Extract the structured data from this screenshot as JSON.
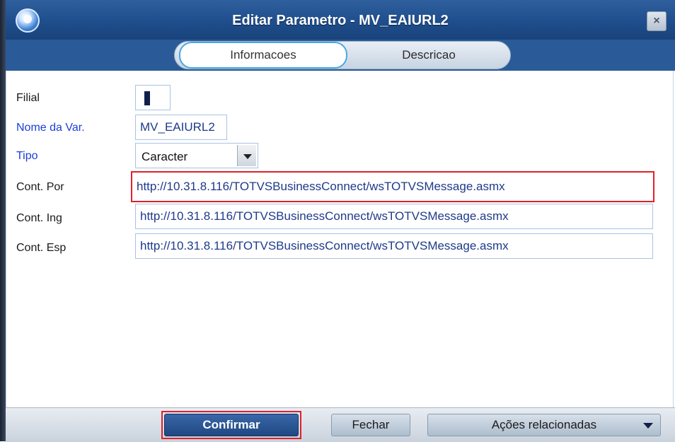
{
  "window": {
    "title": "Editar Parametro - MV_EAIURL2",
    "close_label": "×"
  },
  "tabs": [
    {
      "label": "Informacoes"
    },
    {
      "label": "Descricao"
    }
  ],
  "form": {
    "filial_label": "Filial",
    "nome_label": "Nome da Var.",
    "nome_value": "MV_EAIURL2",
    "tipo_label": "Tipo",
    "tipo_value": "Caracter",
    "cont_por_label": "Cont. Por",
    "cont_por_value": "http://10.31.8.116/TOTVSBusinessConnect/wsTOTVSMessage.asmx",
    "cont_ing_label": "Cont. Ing",
    "cont_ing_value": "http://10.31.8.116/TOTVSBusinessConnect/wsTOTVSMessage.asmx",
    "cont_esp_label": "Cont. Esp",
    "cont_esp_value": "http://10.31.8.116/TOTVSBusinessConnect/wsTOTVSMessage.asmx"
  },
  "footer": {
    "confirm_label": "Confirmar",
    "close_label": "Fechar",
    "actions_label": "Ações relacionadas"
  },
  "colors": {
    "titlebar": "#1f4f8e",
    "highlight": "#e0202a",
    "label_blue": "#1b3fd6",
    "field_text": "#1e3a8a"
  }
}
